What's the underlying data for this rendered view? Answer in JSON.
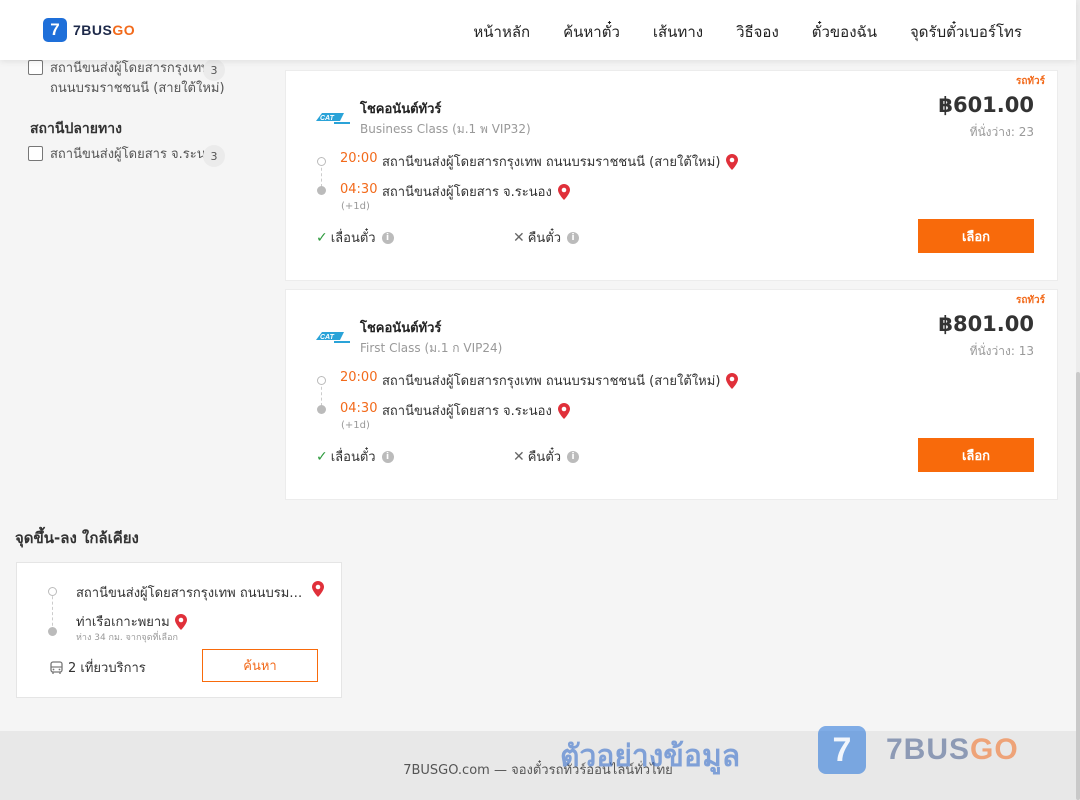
{
  "brand": {
    "badge": "7",
    "name_a": "7BUS",
    "name_b": "GO"
  },
  "nav": [
    "หน้าหลัก",
    "ค้นหาตั๋ว",
    "เส้นทาง",
    "วิธีจอง",
    "ตั๋วของฉัน",
    "จุดรับตั๋วเบอร์โทร"
  ],
  "filters": {
    "origin_item": {
      "label": "สถานีขนส่งผู้โดยสารกรุงเทพ ถนนบรมราชชนนี (สายใต้ใหม่)",
      "count": "3"
    },
    "destination_title": "สถานีปลายทาง",
    "destination_item": {
      "label": "สถานีขนส่งผู้โดยสาร จ.ระนอง",
      "count": "3"
    }
  },
  "trips": [
    {
      "tag": "รถทัวร์",
      "operator": "โชคอนันต์ทัวร์",
      "class": "Business Class (ม.1 พ VIP32)",
      "price": "฿601.00",
      "seats": "ที่นั่งว่าง: 23",
      "depart_time": "20:00",
      "depart_stop": "สถานีขนส่งผู้โดยสารกรุงเทพ ถนนบรมราชชนนี (สายใต้ใหม่)",
      "arrive_time": "04:30",
      "arrive_stop": "สถานีขนส่งผู้โดยสาร จ.ระนอง",
      "plus_day": "(+1d)",
      "feature_change": "เลื่อนตั๋ว",
      "feature_refund": "คืนตั๋ว",
      "select_label": "เลือก"
    },
    {
      "tag": "รถทัวร์",
      "operator": "โชคอนันต์ทัวร์",
      "class": "First Class (ม.1 ก VIP24)",
      "price": "฿801.00",
      "seats": "ที่นั่งว่าง: 13",
      "depart_time": "20:00",
      "depart_stop": "สถานีขนส่งผู้โดยสารกรุงเทพ ถนนบรมราชชนนี (สายใต้ใหม่)",
      "arrive_time": "04:30",
      "arrive_stop": "สถานีขนส่งผู้โดยสาร จ.ระนอง",
      "plus_day": "(+1d)",
      "feature_change": "เลื่อนตั๋ว",
      "feature_refund": "คืนตั๋ว",
      "select_label": "เลือก"
    }
  ],
  "nearby": {
    "title": "จุดขึ้น-ลง ใกล้เคียง",
    "from": "สถานีขนส่งผู้โดยสารกรุงเทพ ถนนบรมราชชนนี (สายใต้ใหม่)",
    "to": "ท่าเรือเกาะพยาม",
    "distance": "ห่าง 34 กม. จากจุดที่เลือก",
    "trips": "2 เที่ยวบริการ",
    "search_label": "ค้นหา"
  },
  "footer": {
    "text": "7BUSGO.com — จองตั๋วรถทัวร์ออนไลน์ทั่วไทย"
  },
  "watermark": {
    "text": "ตัวอย่างข้อมูล",
    "badge": "7",
    "name_a": "7BUS",
    "name_b": "GO"
  },
  "colors": {
    "accent": "#f86a0b",
    "brand_blue": "#1e6fd9",
    "pin": "#e0303a",
    "check": "#2e9b3e"
  },
  "icons": [
    "bus-logo-icon",
    "map-pin-icon",
    "check-icon",
    "x-icon",
    "info-icon",
    "bus-icon"
  ]
}
